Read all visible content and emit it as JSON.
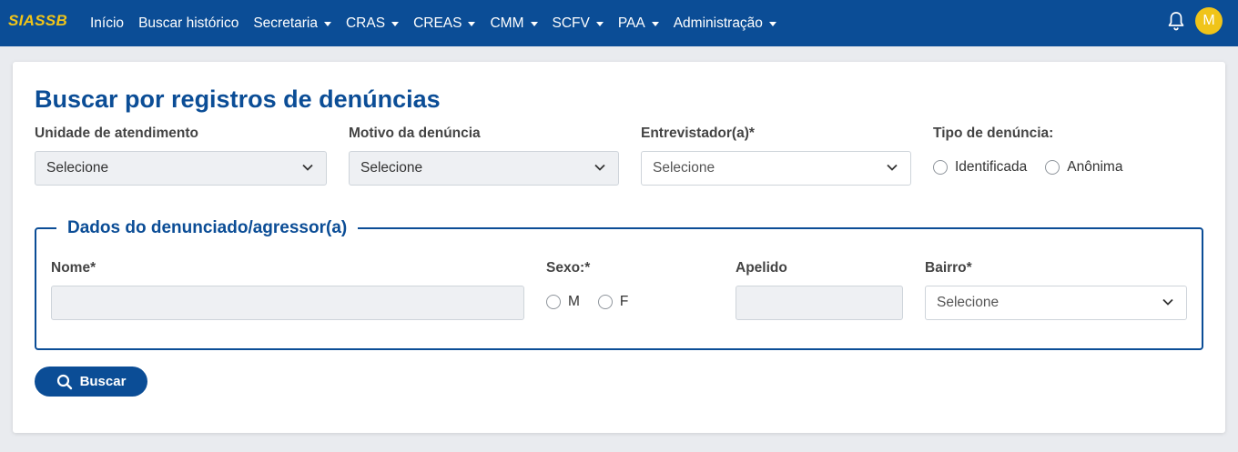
{
  "navbar": {
    "brand": "SIASSB",
    "items": [
      {
        "label": "Início",
        "dropdown": false
      },
      {
        "label": "Buscar histórico",
        "dropdown": false
      },
      {
        "label": "Secretaria",
        "dropdown": true
      },
      {
        "label": "CRAS",
        "dropdown": true
      },
      {
        "label": "CREAS",
        "dropdown": true
      },
      {
        "label": "CMM",
        "dropdown": true
      },
      {
        "label": "SCFV",
        "dropdown": true
      },
      {
        "label": "PAA",
        "dropdown": true
      },
      {
        "label": "Administração",
        "dropdown": true
      }
    ],
    "notification_icon": "bell-icon",
    "avatar_initial": "M"
  },
  "page": {
    "title": "Buscar por registros de denúncias",
    "unidade_label": "Unidade de atendimento",
    "unidade_value": "Selecione",
    "motivo_label": "Motivo da denúncia",
    "motivo_value": "Selecione",
    "entrevistador_label": "Entrevistador(a)*",
    "entrevistador_value": "Selecione",
    "tipo_label": "Tipo de denúncia:",
    "tipo_options": [
      "Identificada",
      "Anônima"
    ]
  },
  "denunciado": {
    "legend": "Dados do denunciado/agressor(a)",
    "nome_label": "Nome*",
    "nome_value": "",
    "sexo_label": "Sexo:*",
    "sexo_options": [
      "M",
      "F"
    ],
    "apelido_label": "Apelido",
    "apelido_value": "",
    "bairro_label": "Bairro*",
    "bairro_value": "Selecione"
  },
  "actions": {
    "search_label": "Buscar"
  },
  "colors": {
    "primary": "#0b4d96",
    "accent": "#f0c419"
  }
}
